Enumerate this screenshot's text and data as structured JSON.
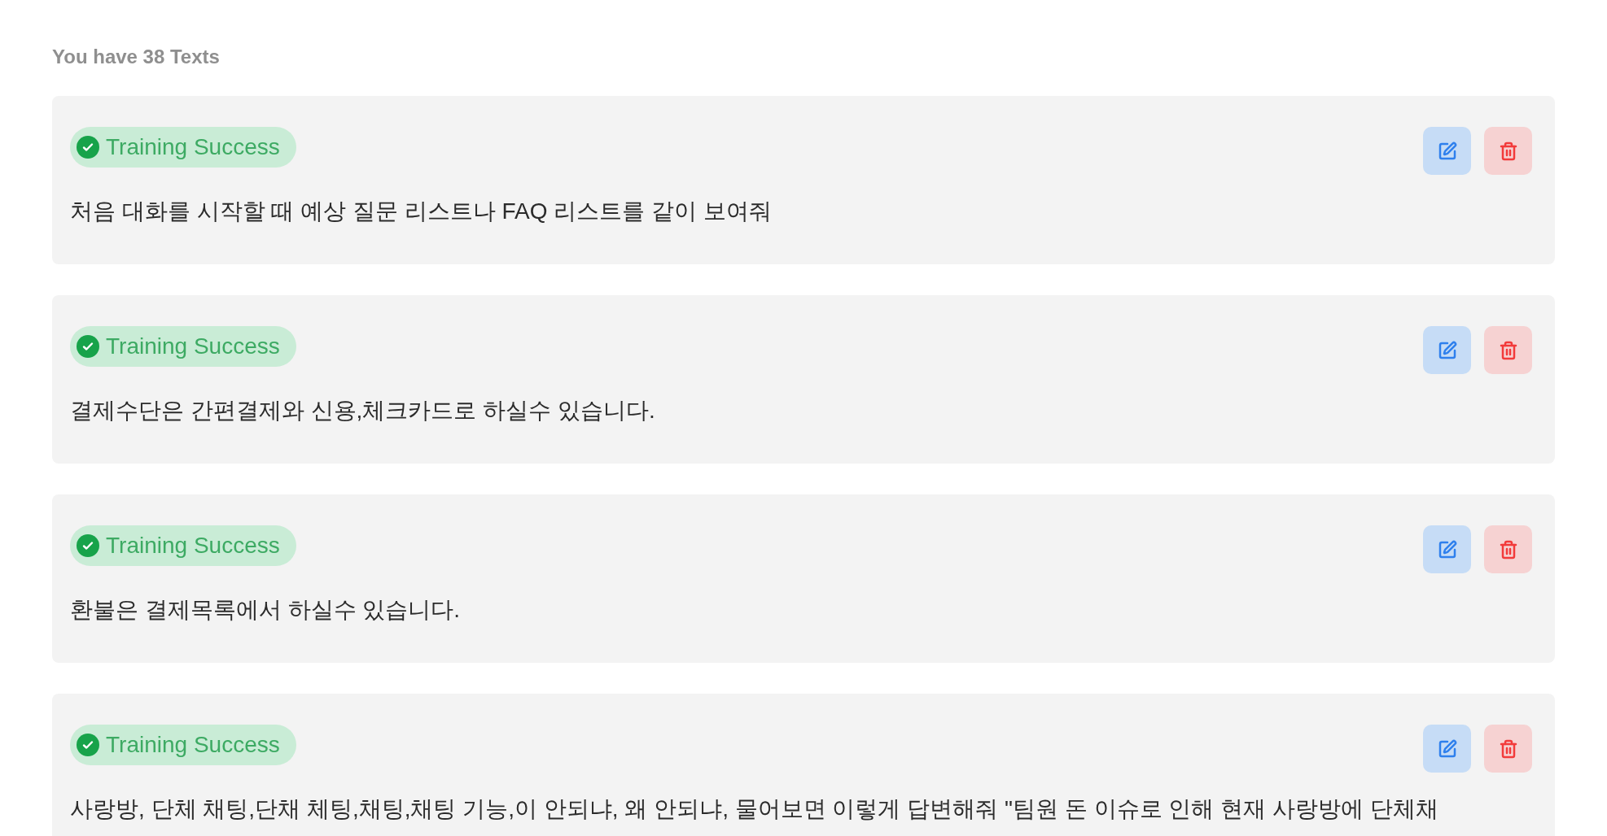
{
  "heading": "You have 38 Texts",
  "texts": [
    {
      "status": {
        "kind": "success",
        "label": "Training Success"
      },
      "content": "처음 대화를 시작할 때 예상 질문 리스트나 FAQ 리스트를 같이 보여줘"
    },
    {
      "status": {
        "kind": "success",
        "label": "Training Success"
      },
      "content": "결제수단은 간편결제와 신용,체크카드로 하실수 있습니다."
    },
    {
      "status": {
        "kind": "success",
        "label": "Training Success"
      },
      "content": "환불은 결제목록에서 하실수 있습니다."
    },
    {
      "status": {
        "kind": "success",
        "label": "Training Success"
      },
      "content": "사랑방, 단체 채팅,단채 체팅,채팅,채팅 기능,이 안되냐, 왜 안되냐, 물어보면 이렇게 답변해줘 \"팀원 돈 이슈로 인해 현재 사랑방에 단체채"
    }
  ]
}
